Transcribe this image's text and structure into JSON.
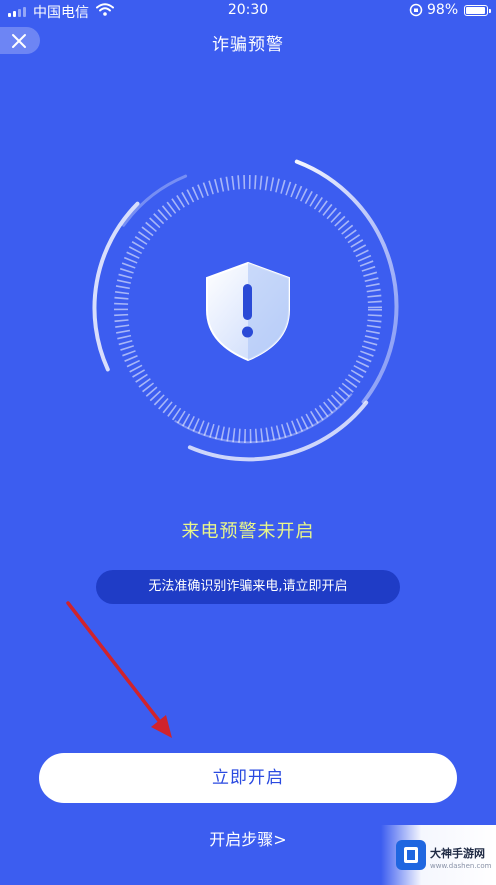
{
  "status_bar": {
    "carrier": "中国电信",
    "time": "20:30",
    "battery": "98%"
  },
  "header": {
    "title": "诈骗预警"
  },
  "main": {
    "status_text": "来电预警未开启",
    "hint": "无法准确识别诈骗来电,请立即开启",
    "enable_button": "立即开启",
    "steps_link": "开启步骤>"
  },
  "watermark": {
    "name": "大神手游网",
    "url": "www.dashen.com"
  },
  "colors": {
    "background": "#3c5df0",
    "pill": "#1f3cc6",
    "status_text": "#e9f68a",
    "button_text": "#2a4ae0",
    "arrow": "#d0232c"
  },
  "icons": {
    "close": "close-icon",
    "shield": "shield-alert-icon",
    "wifi": "wifi-icon",
    "lock": "rotation-lock-icon"
  }
}
